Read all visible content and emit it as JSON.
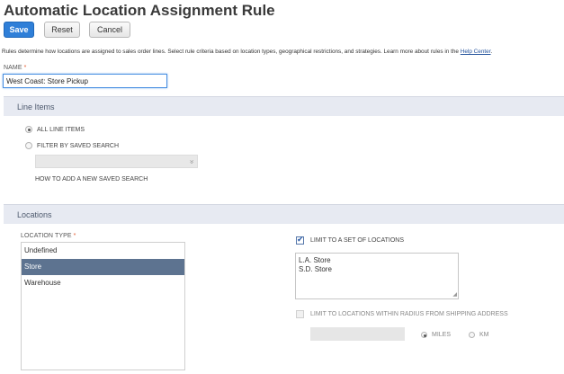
{
  "page": {
    "title": "Automatic Location Assignment Rule"
  },
  "toolbar": {
    "save_label": "Save",
    "reset_label": "Reset",
    "cancel_label": "Cancel"
  },
  "description": {
    "text": "Rules determine how locations are assigned to sales order lines. Select rule criteria based on location types, geographical restrictions, and strategies. Learn more about rules in the ",
    "link": "Help Center",
    "end": "."
  },
  "name_field": {
    "label": "NAME",
    "required_mark": "*",
    "value": "West Coast: Store Pickup"
  },
  "line_items": {
    "section_title": "Line Items",
    "options": [
      {
        "label": "ALL LINE ITEMS",
        "checked": true
      },
      {
        "label": "FILTER BY SAVED SEARCH",
        "checked": false
      }
    ],
    "saved_search_chevron": "»",
    "help_link": "HOW TO ADD A NEW SAVED SEARCH"
  },
  "locations": {
    "section_title": "Locations",
    "type_label": "LOCATION TYPE",
    "required_mark": "*",
    "types": [
      {
        "label": "Undefined",
        "selected": false
      },
      {
        "label": "Store",
        "selected": true
      },
      {
        "label": "Warehouse",
        "selected": false
      }
    ],
    "limit_set": {
      "label": "LIMIT TO A SET OF LOCATIONS",
      "checked": true,
      "values": [
        "L.A. Store",
        "S.D. Store"
      ]
    },
    "limit_radius": {
      "label": "LIMIT TO LOCATIONS WITHIN RADIUS FROM SHIPPING ADDRESS",
      "checked": false,
      "units": [
        {
          "label": "MILES",
          "checked": true
        },
        {
          "label": "KM",
          "checked": false
        }
      ]
    }
  },
  "colors": {
    "primary_button": "#2f7fd8",
    "section_bar": "#e7eaf2",
    "selected_item": "#5d7390"
  }
}
